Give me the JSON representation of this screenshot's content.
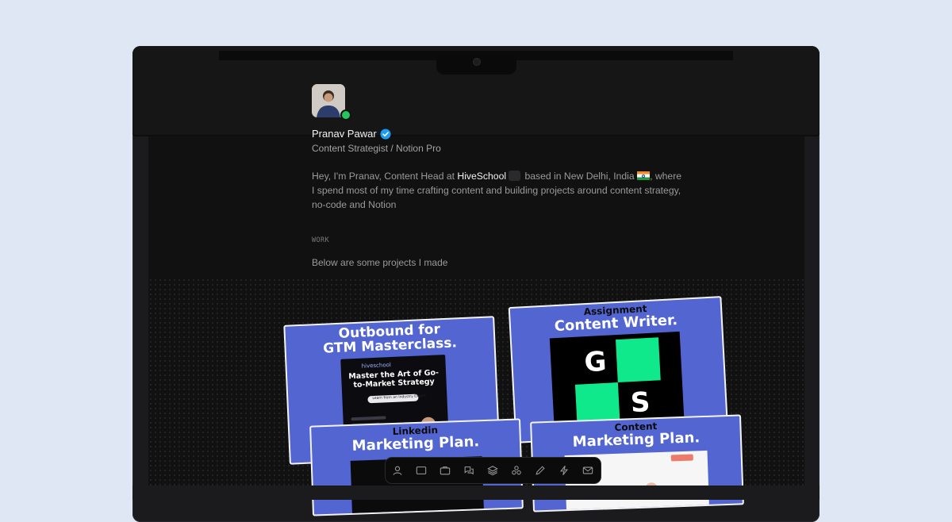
{
  "profile": {
    "name": "Pranav Pawar",
    "role": "Content Strategist / Notion Pro",
    "bio_intro": "Hey, I'm Pranav, Content Head at ",
    "bio_company": "HiveSchool",
    "bio_location": " based in New Delhi, India ",
    "bio_rest": ", where I spend most of my time crafting content and building projects around content strategy, no-code and Notion",
    "status_color": "#22c55e",
    "verified_color": "#1d9bf0"
  },
  "work": {
    "label": "WORK",
    "intro": "Below are some projects I made"
  },
  "projects": [
    {
      "title_line1": "Outbound for",
      "title_line2": "GTM Masterclass.",
      "poster_brand": "hiveschool",
      "poster_head": "Master the Art of Go-to-Market Strategy",
      "poster_pill": "Learn from an Industry Expert"
    },
    {
      "title_line1": "Assignment",
      "title_line2": "Content Writer.",
      "logo_g": "G",
      "logo_s": "S"
    },
    {
      "title_line1": "Linkedin",
      "title_line2": "Marketing Plan."
    },
    {
      "title_line1": "Content",
      "title_line2": "Marketing Plan."
    }
  ],
  "dock": {
    "items": [
      "user-icon",
      "window-icon",
      "briefcase-icon",
      "chat-icon",
      "layers-icon",
      "shapes-icon",
      "pen-icon",
      "bolt-icon",
      "mail-icon"
    ]
  },
  "colors": {
    "card_bg": "#5265d0",
    "accent_green": "#10e88c",
    "page_bg": "#dfe7f5"
  }
}
